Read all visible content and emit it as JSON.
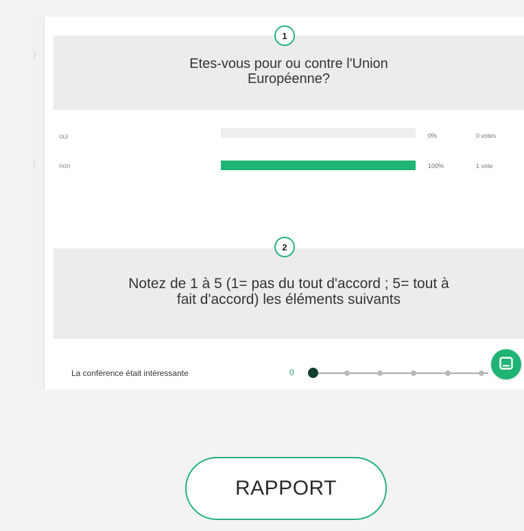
{
  "questions": [
    {
      "number": "1",
      "text": "Etes-vous pour ou contre l'Union Européenne?",
      "options": [
        {
          "label": "oui",
          "percent_text": "0%",
          "fill": 0,
          "votes": "0 votes"
        },
        {
          "label": "non",
          "percent_text": "100%",
          "fill": 1,
          "votes": "1 vote"
        }
      ]
    },
    {
      "number": "2",
      "text": "Notez de 1 à 5 (1= pas du tout d'accord ; 5= tout à fait d'accord) les éléments suivants",
      "rating": {
        "statement": "La conférence était intéressante",
        "value": "0"
      }
    }
  ],
  "actions": {
    "report_label": "RAPPORT"
  },
  "colors": {
    "accent": "#1fb374",
    "question_bg": "#ececec",
    "knob": "#0f3f2f"
  },
  "icons": {
    "chat": "chat-bubble-icon"
  }
}
